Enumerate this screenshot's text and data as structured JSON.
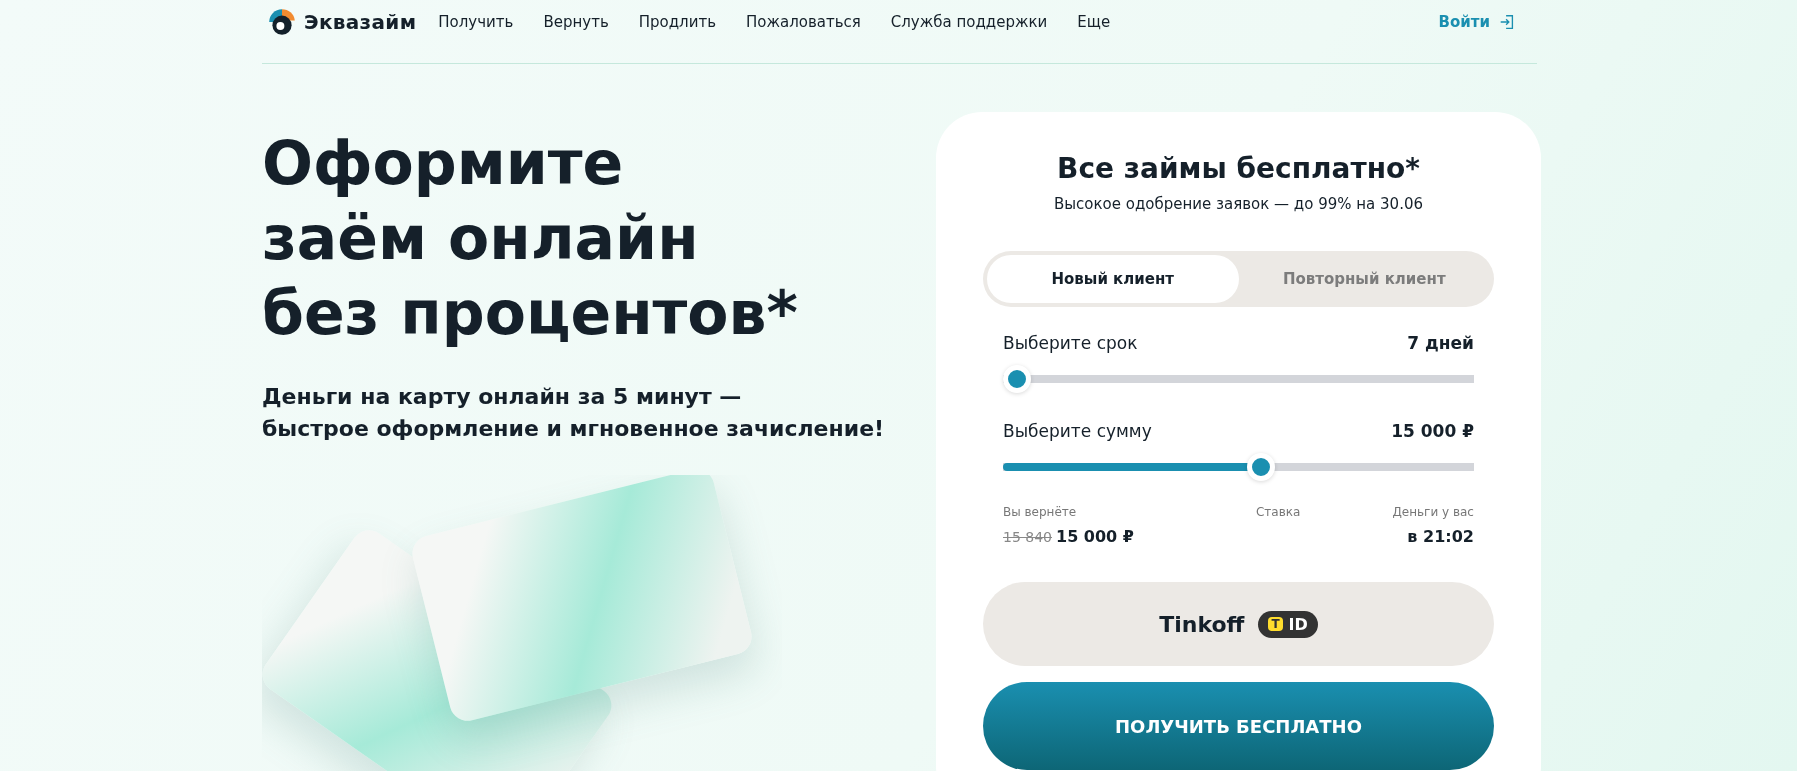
{
  "header": {
    "logo": "Эквазайм",
    "nav": [
      "Получить",
      "Вернуть",
      "Продлить",
      "Пожаловаться",
      "Служба поддержки",
      "Еще"
    ],
    "login": "Войти"
  },
  "hero": {
    "title": [
      "Оформите",
      "заём онлайн",
      "без процентов*"
    ],
    "subtitle": [
      "Деньги на карту онлайн за 5 минут —",
      "быстрое оформление и мгновенное зачисление!"
    ]
  },
  "form": {
    "title": "Все займы бесплатно*",
    "subtitle": "Высокое одобрение заявок — до 99% на 30.06",
    "tabs": [
      {
        "label": "Новый клиент",
        "selected": true
      },
      {
        "label": "Повторный клиент",
        "selected": false
      }
    ],
    "sliders": [
      {
        "label": "Выберите срок",
        "reading": "7 дней",
        "level": 0
      },
      {
        "label": "Выберите сумму",
        "reading": "15 000 ₽",
        "level": 0.55
      }
    ],
    "summary": [
      {
        "label": "Вы вернёте",
        "old_value": "15 840",
        "value": "15 000 ₽"
      },
      {
        "label": "Ставка"
      },
      {
        "label": "Деньги у вас",
        "value": "в 21:02"
      }
    ],
    "tinkoff_button": {
      "label": "Tinkoff",
      "mark": "T",
      "badge": "ID"
    },
    "submit": "ПОЛУЧИТЬ БЕСПЛАТНО"
  }
}
